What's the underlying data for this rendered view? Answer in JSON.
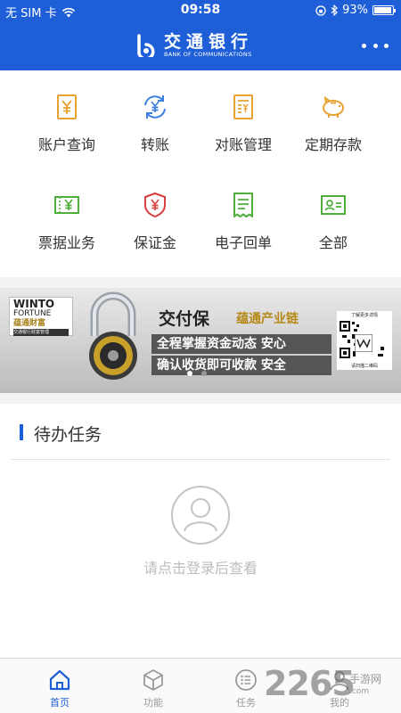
{
  "status_bar": {
    "carrier": "无 SIM 卡",
    "time": "09:58",
    "battery": "93%",
    "battery_level": 0.93
  },
  "header": {
    "brand_cn": "交通银行",
    "brand_en": "BANK OF COMMUNICATIONS",
    "more_icon": "more-dots-icon"
  },
  "menu": {
    "items": [
      {
        "label": "账户查询",
        "icon": "yuan-document-icon"
      },
      {
        "label": "转账",
        "icon": "yuan-transfer-icon"
      },
      {
        "label": "对账管理",
        "icon": "list-document-icon"
      },
      {
        "label": "定期存款",
        "icon": "piggy-bank-icon"
      },
      {
        "label": "票据业务",
        "icon": "bill-yuan-icon"
      },
      {
        "label": "保证金",
        "icon": "shield-yuan-icon"
      },
      {
        "label": "电子回单",
        "icon": "receipt-icon"
      },
      {
        "label": "全部",
        "icon": "card-all-icon"
      }
    ],
    "colors": {
      "orange": "#e8a12e",
      "blue": "#3c7fe0",
      "green": "#4fae3c",
      "red": "#d94040"
    }
  },
  "banner": {
    "logo_line1": "WINTO",
    "logo_line2": "FORTUNE",
    "logo_line3": "蕴通财富",
    "logo_line4": "交通银行财富管理",
    "product": "交付保",
    "partner": "蕴通产业链",
    "line1": "全程掌握资金动态 安心",
    "line2": "确认收货即可收款 安全",
    "qr_top": "了解更多详情",
    "qr_bottom": "请扫描二维码",
    "active_slide": 1,
    "slide_count": 2
  },
  "tasks": {
    "title": "待办任务",
    "hint": "请点击登录后查看",
    "avatar_icon": "user-avatar-icon"
  },
  "tabbar": {
    "tabs": [
      {
        "label": "首页",
        "icon": "home-icon",
        "active": true
      },
      {
        "label": "功能",
        "icon": "cube-icon",
        "active": false
      },
      {
        "label": "任务",
        "icon": "list-circle-icon",
        "active": false
      },
      {
        "label": "我的",
        "icon": "person-icon",
        "active": false
      }
    ]
  },
  "watermark": {
    "number": "2265",
    "cn": "手游网",
    "url": ".com"
  }
}
